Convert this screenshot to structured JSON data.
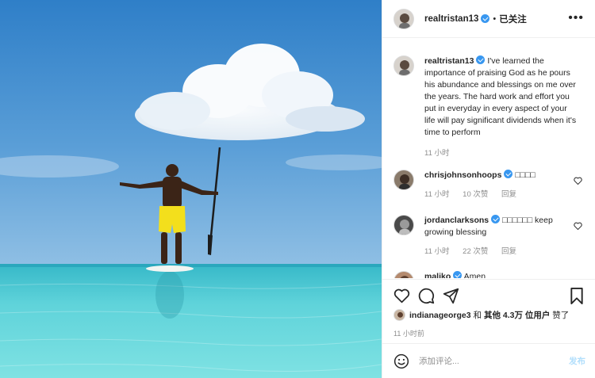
{
  "post": {
    "username": "realtristan13",
    "separator": "•",
    "follow_status": "已关注",
    "more_label": "•••"
  },
  "caption": {
    "username": "realtristan13",
    "text": "I've learned the importance of praising God as he pours his abundance and blessings on me over the years. The hard work and effort you put in everyday in every aspect of your life will pay significant dividends when it's time to perform",
    "time": "11 小时"
  },
  "comments": [
    {
      "username": "chrisjohnsonhoops",
      "text": "□□□□",
      "time": "11 小时",
      "likes": "10 次赞",
      "reply": "回复"
    },
    {
      "username": "jordanclarksons",
      "text": "□□□□□□ keep growing blessing",
      "time": "11 小时",
      "likes": "22 次赞",
      "reply": "回复"
    },
    {
      "username": "maliko",
      "text": "Amen"
    }
  ],
  "likes": {
    "prefix_user": "indianageorge3",
    "connector": " 和 ",
    "others": "其他 4.3万 位用户",
    "suffix": " 赞了"
  },
  "post_time": "11 小时前",
  "comment_box": {
    "placeholder": "添加评论...",
    "submit_label": "发布"
  },
  "icons": {
    "header_avatar": "avatar-icon",
    "verified": "verified-badge-icon",
    "comment_like": "heart-outline-icon",
    "like": "heart-icon",
    "comment": "comment-bubble-icon",
    "share": "paper-plane-icon",
    "save": "bookmark-icon",
    "emoji": "smiley-icon"
  },
  "colors": {
    "verified": "#3897f0",
    "muted": "#8e8e8e",
    "post_button": "#b2dffc",
    "text": "#262626"
  }
}
